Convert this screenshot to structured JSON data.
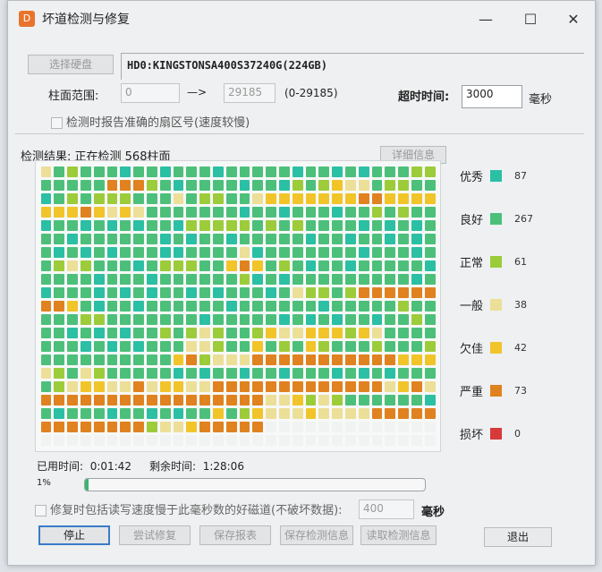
{
  "window": {
    "title": "坏道检测与修复",
    "minimize": "—",
    "maximize": "☐",
    "close": "✕"
  },
  "disk": {
    "select_label": "选择硬盘",
    "name": "HD0:KINGSTONSA400S37240G(224GB)"
  },
  "range": {
    "label": "柱面范围:",
    "from": "0",
    "arrow": "—>",
    "to": "29185",
    "hint": "(0-29185)"
  },
  "timeout": {
    "label": "超时时间:",
    "value": "3000",
    "unit": "毫秒"
  },
  "report_checkbox": {
    "label": "检测时报告准确的扇区号(速度较慢)",
    "checked": false
  },
  "result": {
    "label": "检测结果:",
    "status": "正在检测 568柱面",
    "detail_button": "详细信息"
  },
  "colors": {
    "E": "#2bbfa4",
    "G": "#4cc07a",
    "N": "#9ccc3a",
    "A": "#ecdf97",
    "P": "#f1c52a",
    "S": "#e0821f",
    "B": "#d63a3a",
    "W": "#f1f2f2"
  },
  "legend": [
    {
      "code": "E",
      "label": "优秀",
      "count": "87"
    },
    {
      "code": "G",
      "label": "良好",
      "count": "267"
    },
    {
      "code": "N",
      "label": "正常",
      "count": "61"
    },
    {
      "code": "A",
      "label": "一般",
      "count": "38"
    },
    {
      "code": "P",
      "label": "欠佳",
      "count": "42"
    },
    {
      "code": "S",
      "label": "严重",
      "count": "73"
    },
    {
      "code": "B",
      "label": "损坏",
      "count": "0"
    }
  ],
  "cell_map": [
    "AGNGGGEGGEGGGEGGGGGEGGEGEGGGNN",
    "GGGGGSSSNGEGGGGEGGENGNPAAGNNGG",
    "EGNGNNNGGGAGNNGGAPPPPPPPSSPPPP",
    "PPPSPAPAGGGGGGGEGGEGGGEGGNGNGG",
    "EGGEGEGEGGENNNNNGNGNGGGGEGEGEG",
    "GGEGGGGGGEGEGGEGGGGGEGGEGGEGEG",
    "GEGEGEGGGEEGGGGAEGGGGGGGEGGGEG",
    "GNANGGGEGNNNGGPSPGNGEGGEGGGGGE",
    "GGGGEGGGEGGGGGGNEGEGGGGGGGGGEG",
    "EGGGEGEGEGGEGEGGGEGANNGNSSSSSS",
    "SSPGEGGEGGGGGGEGGGGGGEGGGGGNGG",
    "GGGNNGGGGGGGEGGGGGEGEGEGGEGGNG",
    "GGEGEGEGGNGNANGGNPAAPPPNPAGGGG",
    "GGGEGEGEGGGAANGGPGNGPNGGGNGGGN",
    "GGGGGGGGGGPSNAAASSSSSSSSSSSPPP",
    "ANGANGGGGGEGEGGEGGEGGGEGEGEGGG",
    "GNAPPAASAPPAASSSSSSSSSSSSSAPSA",
    "SSSSSSSSSSSSSSSSSAAPNANGGGGGGE",
    "GEGGGEGGEGEGGPGNPAAAPAAAASSSSS",
    "SSSSSSSSNAAPSSSSSWWWWWWWWWWWWW",
    "WWWWWWWWWWWWWWWWWWWWWWWWWWWWWW"
  ],
  "time": {
    "elapsed_label": "已用时间:",
    "elapsed": "0:01:42",
    "remaining_label": "剩余时间:",
    "remaining": "1:28:06"
  },
  "progress": {
    "label": "1%",
    "percent": 1
  },
  "repair_checkbox": {
    "label": "修复时包括读写速度慢于此毫秒数的好磁道(不破坏数据):",
    "checked": false,
    "value": "400",
    "unit": "毫秒"
  },
  "buttons": {
    "stop": "停止",
    "try_repair": "尝试修复",
    "save_report": "保存报表",
    "save_info": "保存检测信息",
    "load_info": "读取检测信息",
    "exit": "退出"
  }
}
